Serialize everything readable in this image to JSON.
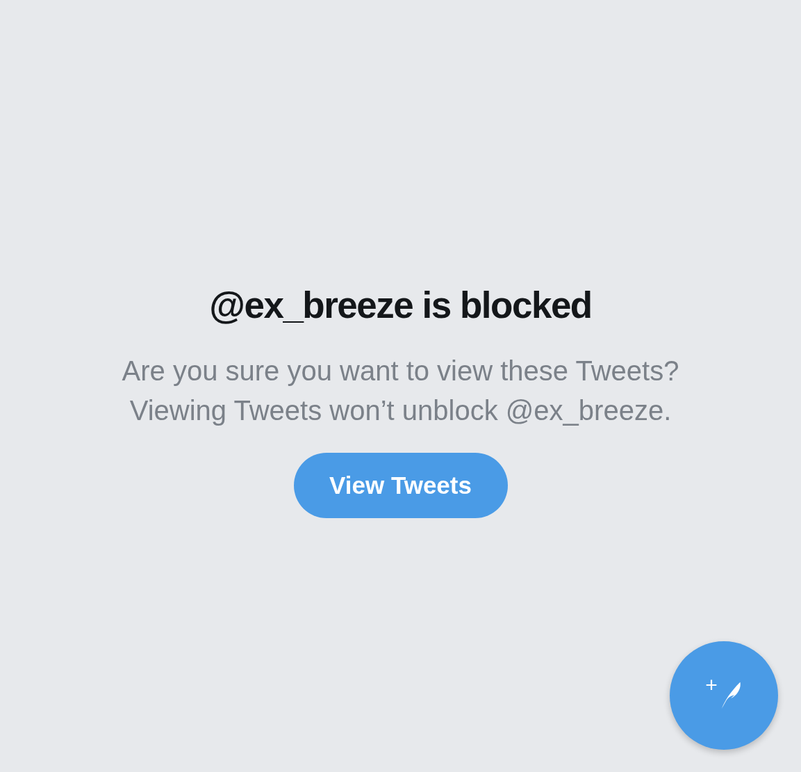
{
  "title": "@ex_breeze is blocked",
  "message": "Are you sure you want to view these Tweets? Viewing Tweets won’t unblock @ex_breeze.",
  "button": {
    "label": "View Tweets"
  },
  "compose_button": {
    "label": "+"
  }
}
